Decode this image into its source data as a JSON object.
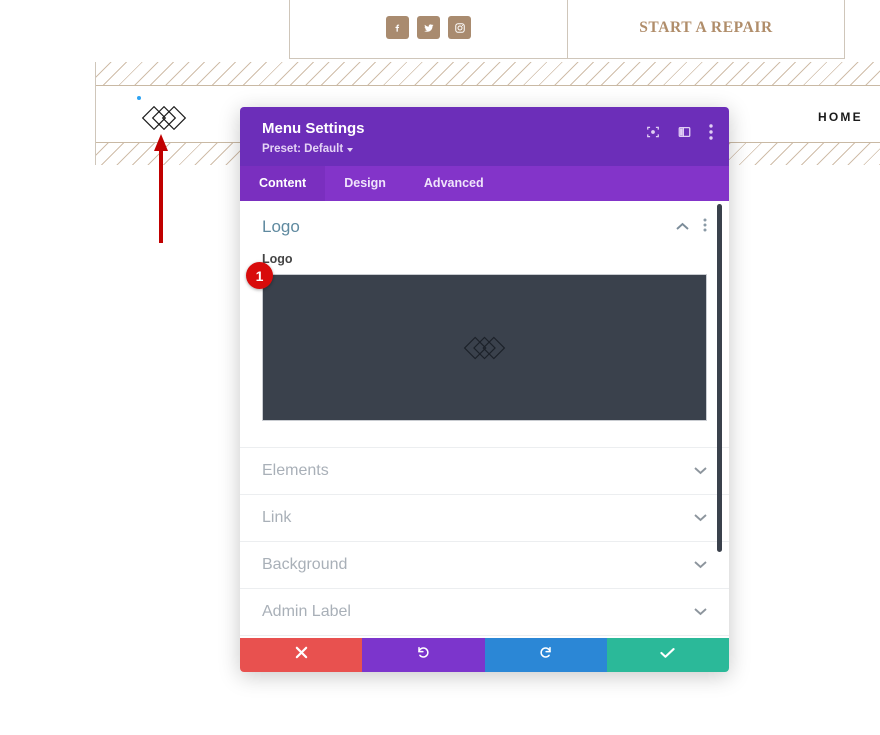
{
  "site": {
    "top_bar": {
      "social_icons": [
        {
          "name": "facebook-icon",
          "label": "Facebook"
        },
        {
          "name": "twitter-icon",
          "label": "Twitter"
        },
        {
          "name": "instagram-icon",
          "label": "Instagram"
        }
      ],
      "cta_label": "START A REPAIR"
    },
    "nav": {
      "home_label": "HOME"
    },
    "logo": {
      "name": "site-logo",
      "description": "three overlapping diamond outlines"
    },
    "annotation": {
      "arrow_color": "#c00000",
      "step_badge": "1"
    },
    "colors": {
      "accent_tan": "#a98b6f",
      "cta_text": "#b08d6a",
      "hatch_line": "#c1a88d"
    }
  },
  "modal": {
    "title": "Menu Settings",
    "preset_label": "Preset: Default",
    "header_icons": [
      {
        "name": "fullscreen-icon",
        "label": "Expand"
      },
      {
        "name": "layout-columns-icon",
        "label": "View Mode"
      },
      {
        "name": "kebab-menu-icon",
        "label": "More Options"
      }
    ],
    "tabs": [
      {
        "label": "Content",
        "active": true
      },
      {
        "label": "Design",
        "active": false
      },
      {
        "label": "Advanced",
        "active": false
      }
    ],
    "logo_section": {
      "title": "Logo",
      "expanded": true,
      "collapse_icon": "chevron-up-icon",
      "options_icon": "kebab-menu-icon",
      "field_label": "Logo",
      "upload_preview_alt": "three overlapping diamond outlines logo",
      "badge": "1"
    },
    "accordions": [
      {
        "label": "Elements",
        "icon": "chevron-down-icon"
      },
      {
        "label": "Link",
        "icon": "chevron-down-icon"
      },
      {
        "label": "Background",
        "icon": "chevron-down-icon"
      },
      {
        "label": "Admin Label",
        "icon": "chevron-down-icon"
      }
    ],
    "footer_buttons": [
      {
        "name": "cancel-button",
        "icon": "close-icon",
        "color": "#e8514f"
      },
      {
        "name": "undo-button",
        "icon": "undo-icon",
        "color": "#7c35cc"
      },
      {
        "name": "redo-button",
        "icon": "redo-icon",
        "color": "#2b87d6"
      },
      {
        "name": "save-button",
        "icon": "check-icon",
        "color": "#2bb999"
      }
    ],
    "colors": {
      "header_purple": "#6C2EB9",
      "tabbar_purple": "#8334c9",
      "active_tab_purple": "#7A2FBF",
      "upload_bg": "#3a414c",
      "badge_red": "#d80b0b"
    }
  }
}
